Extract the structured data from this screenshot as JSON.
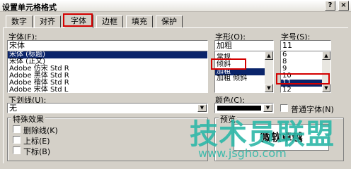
{
  "window": {
    "title": "设置单元格格式",
    "help_glyph": "?",
    "close_glyph": "×"
  },
  "tabs": [
    "数字",
    "对齐",
    "字体",
    "边框",
    "填充",
    "保护"
  ],
  "active_tab": "字体",
  "font": {
    "label": "字体(F):",
    "value": "宋体",
    "items": [
      "宋体 (标题)",
      "宋体 (正文)",
      "Adobe 仿宋 Std R",
      "Adobe 黑体 Std R",
      "Adobe 楷体 Std R",
      "Adobe 宋体 Std L"
    ],
    "selected_index": 0
  },
  "style": {
    "label": "字形(O):",
    "value": "加粗",
    "items": [
      "常规",
      "倾斜",
      "加粗",
      "加粗 倾斜"
    ],
    "selected_index": 2
  },
  "size": {
    "label": "字号(S):",
    "value": "11",
    "items": [
      "6",
      "8",
      "9",
      "10",
      "11",
      "12"
    ],
    "selected_index": 4
  },
  "underline": {
    "label": "下划线(U):",
    "value": "无"
  },
  "color": {
    "label": "颜色(C):",
    "swatch": "#000000"
  },
  "normal_font": {
    "label": "普通字体(N)",
    "checked": false
  },
  "effects": {
    "title": "特殊效果",
    "items": [
      "删除线(K)",
      "上标(E)",
      "下标(B)"
    ]
  },
  "preview": {
    "title": "预览",
    "sample": "微软卓越"
  },
  "watermark": {
    "line1": "技术员联盟",
    "line2": "www.jsgho.com"
  },
  "colors": {
    "accent_red": "#d40000",
    "selection": "#0a246a",
    "watermark": "#2db8a8"
  }
}
